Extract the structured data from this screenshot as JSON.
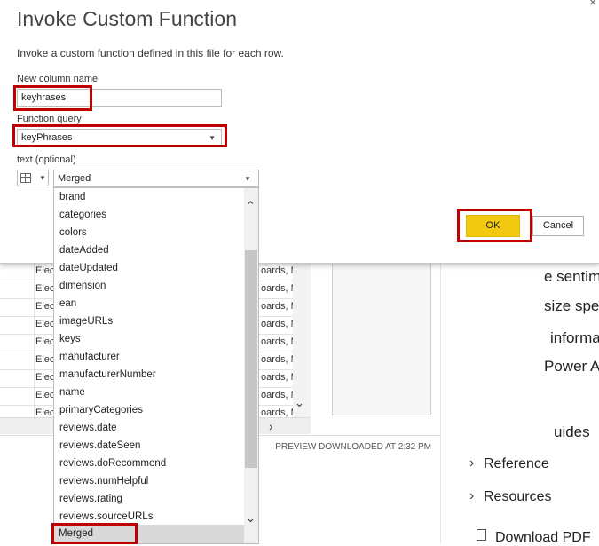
{
  "dialog": {
    "title": "Invoke Custom Function",
    "subtitle": "Invoke a custom function defined in this file for each row.",
    "new_column_label": "New column name",
    "new_column_value": "keyhrases",
    "function_query_label": "Function query",
    "function_query_value": "keyPhrases",
    "text_label": "text (optional)",
    "text_value": "Merged",
    "ok_label": "OK",
    "cancel_label": "Cancel"
  },
  "dropdown": {
    "items": [
      "brand",
      "categories",
      "colors",
      "dateAdded",
      "dateUpdated",
      "dimension",
      "ean",
      "imageURLs",
      "keys",
      "manufacturer",
      "manufacturerNumber",
      "name",
      "primaryCategories",
      "reviews.date",
      "reviews.dateSeen",
      "reviews.doRecommend",
      "reviews.numHelpful",
      "reviews.rating",
      "reviews.sourceURLs",
      "Merged"
    ],
    "selected": "Merged"
  },
  "background_grid": {
    "col_text": "Elec",
    "col_text_right": "oards, M",
    "status": "PREVIEW DOWNLOADED AT 2:32 PM"
  },
  "docs": {
    "lines": [
      "e sentim",
      "size spe",
      "informa",
      "Power A",
      "uides"
    ],
    "nav": [
      "Reference",
      "Resources"
    ],
    "download": "Download PDF"
  },
  "colors": {
    "highlight_red": "#c00000",
    "ok_yellow": "#f2c811"
  }
}
